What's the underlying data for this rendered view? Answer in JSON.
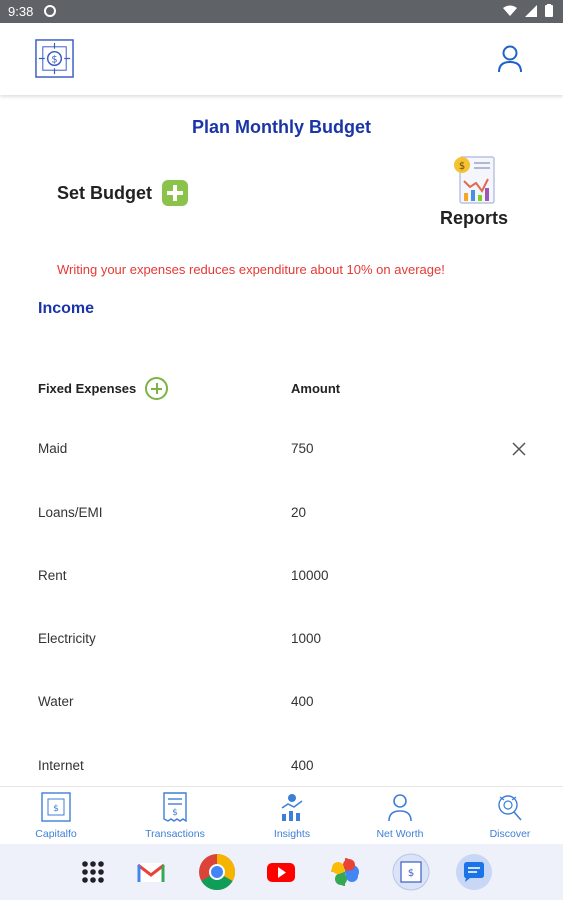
{
  "status_bar": {
    "time": "9:38"
  },
  "header": {
    "logo_icon": "capitalfo-logo-icon",
    "profile_icon": "person-icon"
  },
  "page": {
    "title": "Plan Monthly Budget",
    "set_budget_label": "Set Budget",
    "reports_label": "Reports",
    "tip": "Writing your expenses reduces expenditure about 10% on average!",
    "income_label": "Income"
  },
  "table": {
    "fixed_expenses_label": "Fixed Expenses",
    "amount_label": "Amount",
    "rows": [
      {
        "name": "Maid",
        "amount": "750"
      },
      {
        "name": "Loans/EMI",
        "amount": "20"
      },
      {
        "name": "Rent",
        "amount": "10000"
      },
      {
        "name": "Electricity",
        "amount": "1000"
      },
      {
        "name": "Water",
        "amount": "400"
      },
      {
        "name": "Internet",
        "amount": "400"
      }
    ]
  },
  "bottom_nav": [
    {
      "label": "Capitalfo",
      "icon": "capitalfo-icon"
    },
    {
      "label": "Transactions",
      "icon": "receipt-icon"
    },
    {
      "label": "Insights",
      "icon": "insights-icon"
    },
    {
      "label": "Net Worth",
      "icon": "person-icon"
    },
    {
      "label": "Discover",
      "icon": "discover-icon"
    }
  ],
  "dock": [
    "apps-grid-icon",
    "gmail-icon",
    "chrome-icon",
    "youtube-icon",
    "photos-icon",
    "capitalfo-icon",
    "messages-icon"
  ],
  "colors": {
    "title_blue": "#1a35a8",
    "tip_red": "#e53935",
    "accent_green": "#8bc34a",
    "nav_blue": "#3d7fd6"
  }
}
